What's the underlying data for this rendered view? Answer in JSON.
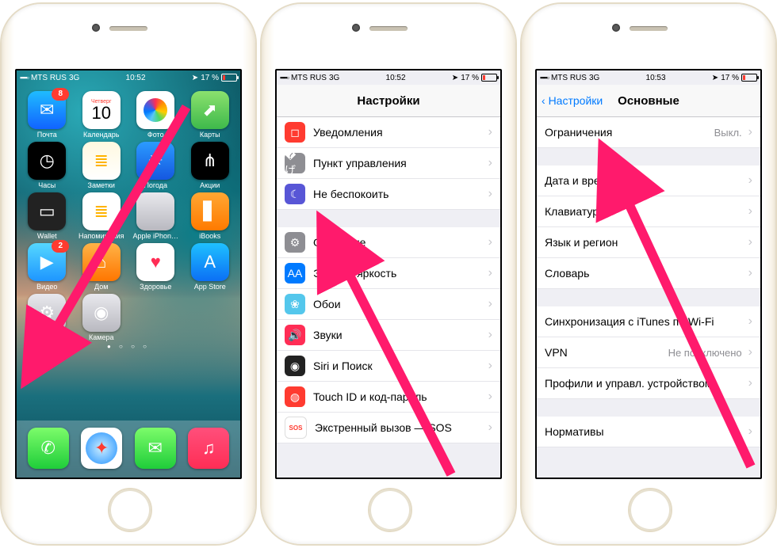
{
  "status": {
    "signal": "▪▪▪▪▫",
    "carrier": "MTS RUS",
    "net": "3G",
    "time1": "10:52",
    "time2": "10:52",
    "time3": "10:53",
    "loc": "➤",
    "bat_pct": "17 %"
  },
  "home": {
    "cal_day": "Четверг",
    "cal_num": "10",
    "apps": [
      {
        "label": "Почта",
        "name": "mail",
        "bg": "bg-mail",
        "glyph": "✉︎",
        "badge": "8"
      },
      {
        "label": "Календарь",
        "name": "calendar",
        "bg": "bg-cal"
      },
      {
        "label": "Фото",
        "name": "photos",
        "bg": "bg-photos",
        "glyph": "✿"
      },
      {
        "label": "Карты",
        "name": "maps",
        "bg": "bg-maps",
        "glyph": "⬈"
      },
      {
        "label": "Часы",
        "name": "clock",
        "bg": "bg-clock",
        "glyph": "◷"
      },
      {
        "label": "Заметки",
        "name": "notes",
        "bg": "bg-notes",
        "glyph": "≣"
      },
      {
        "label": "Погода",
        "name": "weather",
        "bg": "bg-weather",
        "glyph": "☀"
      },
      {
        "label": "Акции",
        "name": "stocks",
        "bg": "bg-stocks",
        "glyph": "⋔"
      },
      {
        "label": "Wallet",
        "name": "wallet",
        "bg": "bg-wallet",
        "glyph": "▭"
      },
      {
        "label": "Напоминания",
        "name": "reminders",
        "bg": "bg-rem",
        "glyph": "≣"
      },
      {
        "label": "Apple iPhon…",
        "name": "tips",
        "bg": "bg-settings",
        "glyph": ""
      },
      {
        "label": "iBooks",
        "name": "ibooks",
        "bg": "bg-ibooks",
        "glyph": "▋"
      },
      {
        "label": "Видео",
        "name": "videos",
        "bg": "bg-videos",
        "glyph": "▶",
        "badge": "2"
      },
      {
        "label": "Дом",
        "name": "home",
        "bg": "bg-home",
        "glyph": "⌂"
      },
      {
        "label": "Здоровье",
        "name": "health",
        "bg": "bg-health",
        "glyph": "♥"
      },
      {
        "label": "App Store",
        "name": "appstore",
        "bg": "bg-appstore",
        "glyph": "A"
      },
      {
        "label": "Настройки",
        "name": "settings",
        "bg": "bg-settings",
        "glyph": "⚙"
      },
      {
        "label": "Камера",
        "name": "camera",
        "bg": "bg-camera",
        "glyph": "◉"
      }
    ],
    "dock": [
      {
        "name": "phone",
        "bg": "bg-phone",
        "glyph": "✆"
      },
      {
        "name": "safari",
        "bg": "bg-safari",
        "glyph": "◎"
      },
      {
        "name": "messages",
        "bg": "bg-msg",
        "glyph": "✉︎"
      },
      {
        "name": "music",
        "bg": "bg-music",
        "glyph": "♫"
      }
    ]
  },
  "settings": {
    "title": "Настройки",
    "groups": [
      [
        {
          "label": "Уведомления",
          "name": "notifications",
          "color": "#ff3b30",
          "glyph": "◻"
        },
        {
          "label": "Пункт управления",
          "name": "control-center",
          "color": "#8e8e93",
          "glyph": "�げ"
        },
        {
          "label": "Не беспокоить",
          "name": "dnd",
          "color": "#5856d6",
          "glyph": "☾"
        }
      ],
      [
        {
          "label": "Основные",
          "name": "general",
          "color": "#8e8e93",
          "glyph": "⚙"
        },
        {
          "label": "Экран и яркость",
          "name": "display",
          "color": "#007aff",
          "glyph": "AA"
        },
        {
          "label": "Обои",
          "name": "wallpaper",
          "color": "#54c7ec",
          "glyph": "❀"
        },
        {
          "label": "Звуки",
          "name": "sounds",
          "color": "#ff2d55",
          "glyph": "🔊"
        },
        {
          "label": "Siri и Поиск",
          "name": "siri",
          "color": "#222",
          "glyph": "◉"
        },
        {
          "label": "Touch ID и код-пароль",
          "name": "touchid",
          "color": "#ff3b30",
          "glyph": "◍"
        },
        {
          "label": "Экстренный вызов — SOS",
          "name": "sos",
          "color": "#fff",
          "glyph": "SOS",
          "textcolor": "#ff3b30"
        }
      ]
    ]
  },
  "general": {
    "back": "Настройки",
    "title": "Основные",
    "rows": [
      [
        {
          "label": "Ограничения",
          "name": "restrictions",
          "value": "Выкл."
        }
      ],
      [
        {
          "label": "Дата и время",
          "name": "date-time"
        },
        {
          "label": "Клавиатура",
          "name": "keyboard"
        },
        {
          "label": "Язык и регион",
          "name": "language"
        },
        {
          "label": "Словарь",
          "name": "dictionary"
        }
      ],
      [
        {
          "label": "Синхронизация с iTunes по Wi-Fi",
          "name": "itunes-wifi"
        },
        {
          "label": "VPN",
          "name": "vpn",
          "value": "Не подключено"
        },
        {
          "label": "Профили и управл. устройством",
          "name": "profiles"
        }
      ],
      [
        {
          "label": "Нормативы",
          "name": "regulatory"
        }
      ]
    ]
  }
}
